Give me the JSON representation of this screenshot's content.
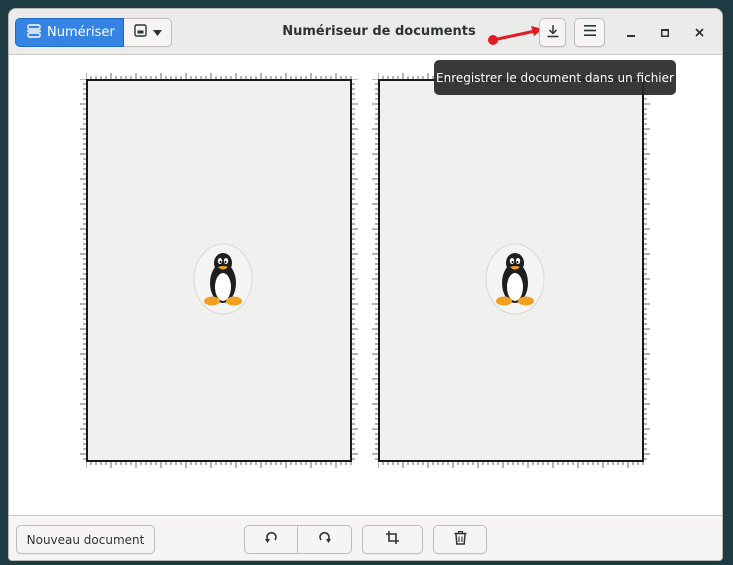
{
  "window": {
    "title": "Numériseur de documents"
  },
  "header": {
    "scan_label": "Numériser",
    "scan_icon": "scanner-icon",
    "scan_type_icon": "image-icon",
    "save_icon": "download-icon",
    "menu_icon": "hamburger-icon",
    "window_controls": [
      "minimize-icon",
      "maximize-icon",
      "close-icon"
    ]
  },
  "tooltip": {
    "text": "Enregistrer le document dans un fichier"
  },
  "pages": [
    {
      "image": "tux-penguin"
    },
    {
      "image": "tux-penguin"
    }
  ],
  "bottom": {
    "new_document_label": "Nouveau document",
    "rotate_left_icon": "rotate-left-icon",
    "rotate_right_icon": "rotate-right-icon",
    "crop_icon": "crop-icon",
    "delete_icon": "trash-icon"
  },
  "colors": {
    "accent": "#3584e4",
    "annotation": "#e01b24",
    "tooltip_bg": "#282828"
  }
}
